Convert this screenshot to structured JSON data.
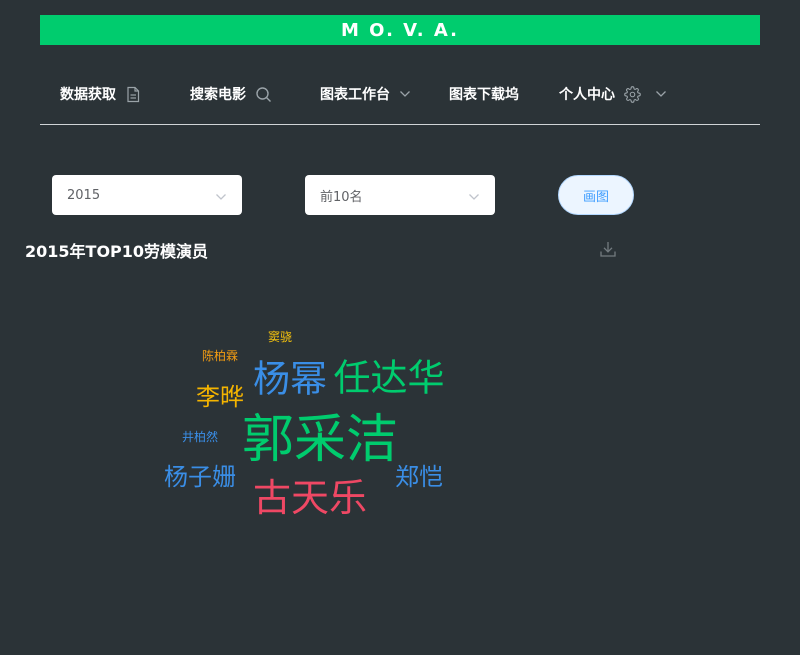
{
  "brand": {
    "title": "M O. V. A.",
    "color": "#00cc6e"
  },
  "nav": {
    "items": [
      {
        "label": "数据获取",
        "icon": "document-icon"
      },
      {
        "label": "搜索电影",
        "icon": "search-icon"
      },
      {
        "label": "图表工作台",
        "icon": "chevron-down-icon"
      },
      {
        "label": "图表下载坞",
        "icon": ""
      },
      {
        "label": "个人中心",
        "icon": "gear-icon"
      }
    ]
  },
  "filters": {
    "year": {
      "value": "2015"
    },
    "rank": {
      "value": "前10名"
    },
    "draw_label": "画图"
  },
  "chart": {
    "title": "2015年TOP10劳模演员",
    "download_icon": "download-icon"
  },
  "chart_data": {
    "type": "wordcloud",
    "words": [
      {
        "text": "郭采洁",
        "color": "#00cc6e"
      },
      {
        "text": "古天乐",
        "color": "#ef4864"
      },
      {
        "text": "杨幂",
        "color": "#3a8ee6"
      },
      {
        "text": "任达华",
        "color": "#00cc6e"
      },
      {
        "text": "李晔",
        "color": "#f4b400"
      },
      {
        "text": "郑恺",
        "color": "#3a8ee6"
      },
      {
        "text": "杨子姗",
        "color": "#3a8ee6"
      },
      {
        "text": "陈柏霖",
        "color": "#f39c12"
      },
      {
        "text": "窦骁",
        "color": "#f4c20d"
      },
      {
        "text": "井柏然",
        "color": "#3a8ee6"
      }
    ]
  }
}
